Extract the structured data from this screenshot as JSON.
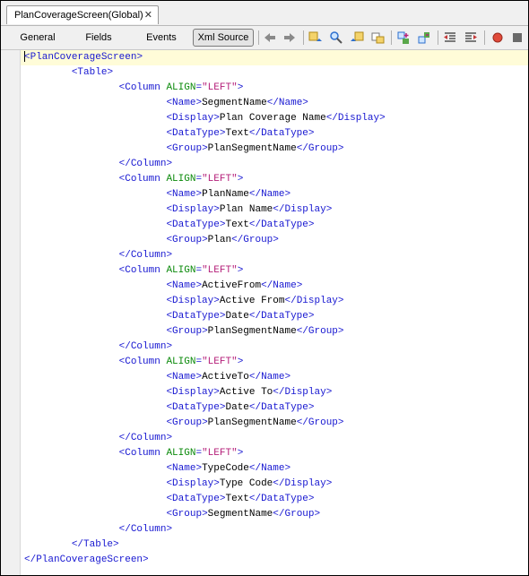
{
  "doc_tab": {
    "title": "PlanCoverageScreen(Global)",
    "close_glyph": "✕"
  },
  "view_tabs": [
    {
      "label": "General",
      "active": false
    },
    {
      "label": "Fields",
      "active": false
    },
    {
      "label": "Events",
      "active": false
    },
    {
      "label": "Xml Source",
      "active": true
    }
  ],
  "toolbar_icons": [
    "back-arrow-icon",
    "forward-arrow-icon",
    "find-previous-icon",
    "find-icon",
    "find-next-icon",
    "find-selection-icon",
    "toggle-bookmark-icon",
    "next-bookmark-icon",
    "shift-left-icon",
    "shift-right-icon",
    "start-macro-icon",
    "stop-macro-icon"
  ],
  "colors": {
    "tag": "#1717d1",
    "attr_name": "#0b8a0b",
    "attr_value": "#b5207a",
    "text": "#000000",
    "current_line": "#fffcd8"
  },
  "xml_lines": [
    {
      "indent": 0,
      "kind": "open",
      "tag": "PlanCoverageScreen"
    },
    {
      "indent": 1,
      "kind": "open",
      "tag": "Table"
    },
    {
      "indent": 2,
      "kind": "open",
      "tag": "Column",
      "attr": "ALIGN",
      "value": "\"LEFT\""
    },
    {
      "indent": 3,
      "kind": "elem",
      "tag": "Name",
      "text": "SegmentName"
    },
    {
      "indent": 3,
      "kind": "elem",
      "tag": "Display",
      "text": "Plan Coverage Name"
    },
    {
      "indent": 3,
      "kind": "elem",
      "tag": "DataType",
      "text": "Text"
    },
    {
      "indent": 3,
      "kind": "elem",
      "tag": "Group",
      "text": "PlanSegmentName"
    },
    {
      "indent": 2,
      "kind": "close",
      "tag": "Column"
    },
    {
      "indent": 2,
      "kind": "open",
      "tag": "Column",
      "attr": "ALIGN",
      "value": "\"LEFT\""
    },
    {
      "indent": 3,
      "kind": "elem",
      "tag": "Name",
      "text": "PlanName"
    },
    {
      "indent": 3,
      "kind": "elem",
      "tag": "Display",
      "text": "Plan Name"
    },
    {
      "indent": 3,
      "kind": "elem",
      "tag": "DataType",
      "text": "Text"
    },
    {
      "indent": 3,
      "kind": "elem",
      "tag": "Group",
      "text": "Plan"
    },
    {
      "indent": 2,
      "kind": "close",
      "tag": "Column"
    },
    {
      "indent": 2,
      "kind": "open",
      "tag": "Column",
      "attr": "ALIGN",
      "value": "\"LEFT\""
    },
    {
      "indent": 3,
      "kind": "elem",
      "tag": "Name",
      "text": "ActiveFrom"
    },
    {
      "indent": 3,
      "kind": "elem",
      "tag": "Display",
      "text": "Active From"
    },
    {
      "indent": 3,
      "kind": "elem",
      "tag": "DataType",
      "text": "Date"
    },
    {
      "indent": 3,
      "kind": "elem",
      "tag": "Group",
      "text": "PlanSegmentName"
    },
    {
      "indent": 2,
      "kind": "close",
      "tag": "Column"
    },
    {
      "indent": 2,
      "kind": "open",
      "tag": "Column",
      "attr": "ALIGN",
      "value": "\"LEFT\""
    },
    {
      "indent": 3,
      "kind": "elem",
      "tag": "Name",
      "text": "ActiveTo"
    },
    {
      "indent": 3,
      "kind": "elem",
      "tag": "Display",
      "text": "Active To"
    },
    {
      "indent": 3,
      "kind": "elem",
      "tag": "DataType",
      "text": "Date"
    },
    {
      "indent": 3,
      "kind": "elem",
      "tag": "Group",
      "text": "PlanSegmentName"
    },
    {
      "indent": 2,
      "kind": "close",
      "tag": "Column"
    },
    {
      "indent": 2,
      "kind": "open",
      "tag": "Column",
      "attr": "ALIGN",
      "value": "\"LEFT\""
    },
    {
      "indent": 3,
      "kind": "elem",
      "tag": "Name",
      "text": "TypeCode"
    },
    {
      "indent": 3,
      "kind": "elem",
      "tag": "Display",
      "text": "Type Code"
    },
    {
      "indent": 3,
      "kind": "elem",
      "tag": "DataType",
      "text": "Text"
    },
    {
      "indent": 3,
      "kind": "elem",
      "tag": "Group",
      "text": "SegmentName"
    },
    {
      "indent": 2,
      "kind": "close",
      "tag": "Column"
    },
    {
      "indent": 1,
      "kind": "close",
      "tag": "Table"
    },
    {
      "indent": 0,
      "kind": "close",
      "tag": "PlanCoverageScreen"
    }
  ]
}
